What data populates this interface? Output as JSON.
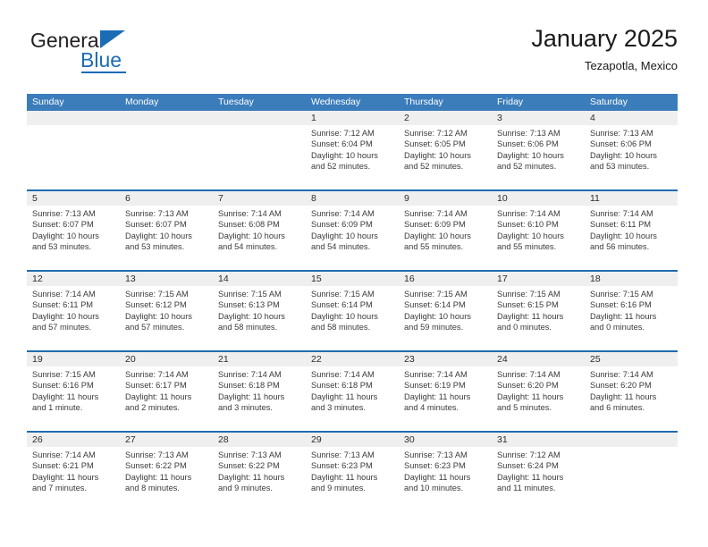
{
  "logo": {
    "word_one": "General",
    "word_two": "Blue",
    "triangle": "blue-triangle-icon",
    "accent_color": "#1b6cb5"
  },
  "header": {
    "title": "January 2025",
    "subtitle": "Tezapotla, Mexico"
  },
  "calendar": {
    "header_bg": "#3b7cbb",
    "week_separator_color": "#1f6cb0",
    "day_band_bg": "#efefef",
    "day_names": [
      "Sunday",
      "Monday",
      "Tuesday",
      "Wednesday",
      "Thursday",
      "Friday",
      "Saturday"
    ],
    "weeks": [
      [
        {
          "day": "",
          "lines": []
        },
        {
          "day": "",
          "lines": []
        },
        {
          "day": "",
          "lines": []
        },
        {
          "day": "1",
          "lines": [
            "Sunrise: 7:12 AM",
            "Sunset: 6:04 PM",
            "Daylight: 10 hours",
            "and 52 minutes."
          ]
        },
        {
          "day": "2",
          "lines": [
            "Sunrise: 7:12 AM",
            "Sunset: 6:05 PM",
            "Daylight: 10 hours",
            "and 52 minutes."
          ]
        },
        {
          "day": "3",
          "lines": [
            "Sunrise: 7:13 AM",
            "Sunset: 6:06 PM",
            "Daylight: 10 hours",
            "and 52 minutes."
          ]
        },
        {
          "day": "4",
          "lines": [
            "Sunrise: 7:13 AM",
            "Sunset: 6:06 PM",
            "Daylight: 10 hours",
            "and 53 minutes."
          ]
        }
      ],
      [
        {
          "day": "5",
          "lines": [
            "Sunrise: 7:13 AM",
            "Sunset: 6:07 PM",
            "Daylight: 10 hours",
            "and 53 minutes."
          ]
        },
        {
          "day": "6",
          "lines": [
            "Sunrise: 7:13 AM",
            "Sunset: 6:07 PM",
            "Daylight: 10 hours",
            "and 53 minutes."
          ]
        },
        {
          "day": "7",
          "lines": [
            "Sunrise: 7:14 AM",
            "Sunset: 6:08 PM",
            "Daylight: 10 hours",
            "and 54 minutes."
          ]
        },
        {
          "day": "8",
          "lines": [
            "Sunrise: 7:14 AM",
            "Sunset: 6:09 PM",
            "Daylight: 10 hours",
            "and 54 minutes."
          ]
        },
        {
          "day": "9",
          "lines": [
            "Sunrise: 7:14 AM",
            "Sunset: 6:09 PM",
            "Daylight: 10 hours",
            "and 55 minutes."
          ]
        },
        {
          "day": "10",
          "lines": [
            "Sunrise: 7:14 AM",
            "Sunset: 6:10 PM",
            "Daylight: 10 hours",
            "and 55 minutes."
          ]
        },
        {
          "day": "11",
          "lines": [
            "Sunrise: 7:14 AM",
            "Sunset: 6:11 PM",
            "Daylight: 10 hours",
            "and 56 minutes."
          ]
        }
      ],
      [
        {
          "day": "12",
          "lines": [
            "Sunrise: 7:14 AM",
            "Sunset: 6:11 PM",
            "Daylight: 10 hours",
            "and 57 minutes."
          ]
        },
        {
          "day": "13",
          "lines": [
            "Sunrise: 7:15 AM",
            "Sunset: 6:12 PM",
            "Daylight: 10 hours",
            "and 57 minutes."
          ]
        },
        {
          "day": "14",
          "lines": [
            "Sunrise: 7:15 AM",
            "Sunset: 6:13 PM",
            "Daylight: 10 hours",
            "and 58 minutes."
          ]
        },
        {
          "day": "15",
          "lines": [
            "Sunrise: 7:15 AM",
            "Sunset: 6:14 PM",
            "Daylight: 10 hours",
            "and 58 minutes."
          ]
        },
        {
          "day": "16",
          "lines": [
            "Sunrise: 7:15 AM",
            "Sunset: 6:14 PM",
            "Daylight: 10 hours",
            "and 59 minutes."
          ]
        },
        {
          "day": "17",
          "lines": [
            "Sunrise: 7:15 AM",
            "Sunset: 6:15 PM",
            "Daylight: 11 hours",
            "and 0 minutes."
          ]
        },
        {
          "day": "18",
          "lines": [
            "Sunrise: 7:15 AM",
            "Sunset: 6:16 PM",
            "Daylight: 11 hours",
            "and 0 minutes."
          ]
        }
      ],
      [
        {
          "day": "19",
          "lines": [
            "Sunrise: 7:15 AM",
            "Sunset: 6:16 PM",
            "Daylight: 11 hours",
            "and 1 minute."
          ]
        },
        {
          "day": "20",
          "lines": [
            "Sunrise: 7:14 AM",
            "Sunset: 6:17 PM",
            "Daylight: 11 hours",
            "and 2 minutes."
          ]
        },
        {
          "day": "21",
          "lines": [
            "Sunrise: 7:14 AM",
            "Sunset: 6:18 PM",
            "Daylight: 11 hours",
            "and 3 minutes."
          ]
        },
        {
          "day": "22",
          "lines": [
            "Sunrise: 7:14 AM",
            "Sunset: 6:18 PM",
            "Daylight: 11 hours",
            "and 3 minutes."
          ]
        },
        {
          "day": "23",
          "lines": [
            "Sunrise: 7:14 AM",
            "Sunset: 6:19 PM",
            "Daylight: 11 hours",
            "and 4 minutes."
          ]
        },
        {
          "day": "24",
          "lines": [
            "Sunrise: 7:14 AM",
            "Sunset: 6:20 PM",
            "Daylight: 11 hours",
            "and 5 minutes."
          ]
        },
        {
          "day": "25",
          "lines": [
            "Sunrise: 7:14 AM",
            "Sunset: 6:20 PM",
            "Daylight: 11 hours",
            "and 6 minutes."
          ]
        }
      ],
      [
        {
          "day": "26",
          "lines": [
            "Sunrise: 7:14 AM",
            "Sunset: 6:21 PM",
            "Daylight: 11 hours",
            "and 7 minutes."
          ]
        },
        {
          "day": "27",
          "lines": [
            "Sunrise: 7:13 AM",
            "Sunset: 6:22 PM",
            "Daylight: 11 hours",
            "and 8 minutes."
          ]
        },
        {
          "day": "28",
          "lines": [
            "Sunrise: 7:13 AM",
            "Sunset: 6:22 PM",
            "Daylight: 11 hours",
            "and 9 minutes."
          ]
        },
        {
          "day": "29",
          "lines": [
            "Sunrise: 7:13 AM",
            "Sunset: 6:23 PM",
            "Daylight: 11 hours",
            "and 9 minutes."
          ]
        },
        {
          "day": "30",
          "lines": [
            "Sunrise: 7:13 AM",
            "Sunset: 6:23 PM",
            "Daylight: 11 hours",
            "and 10 minutes."
          ]
        },
        {
          "day": "31",
          "lines": [
            "Sunrise: 7:12 AM",
            "Sunset: 6:24 PM",
            "Daylight: 11 hours",
            "and 11 minutes."
          ]
        },
        {
          "day": "",
          "lines": []
        }
      ]
    ]
  }
}
